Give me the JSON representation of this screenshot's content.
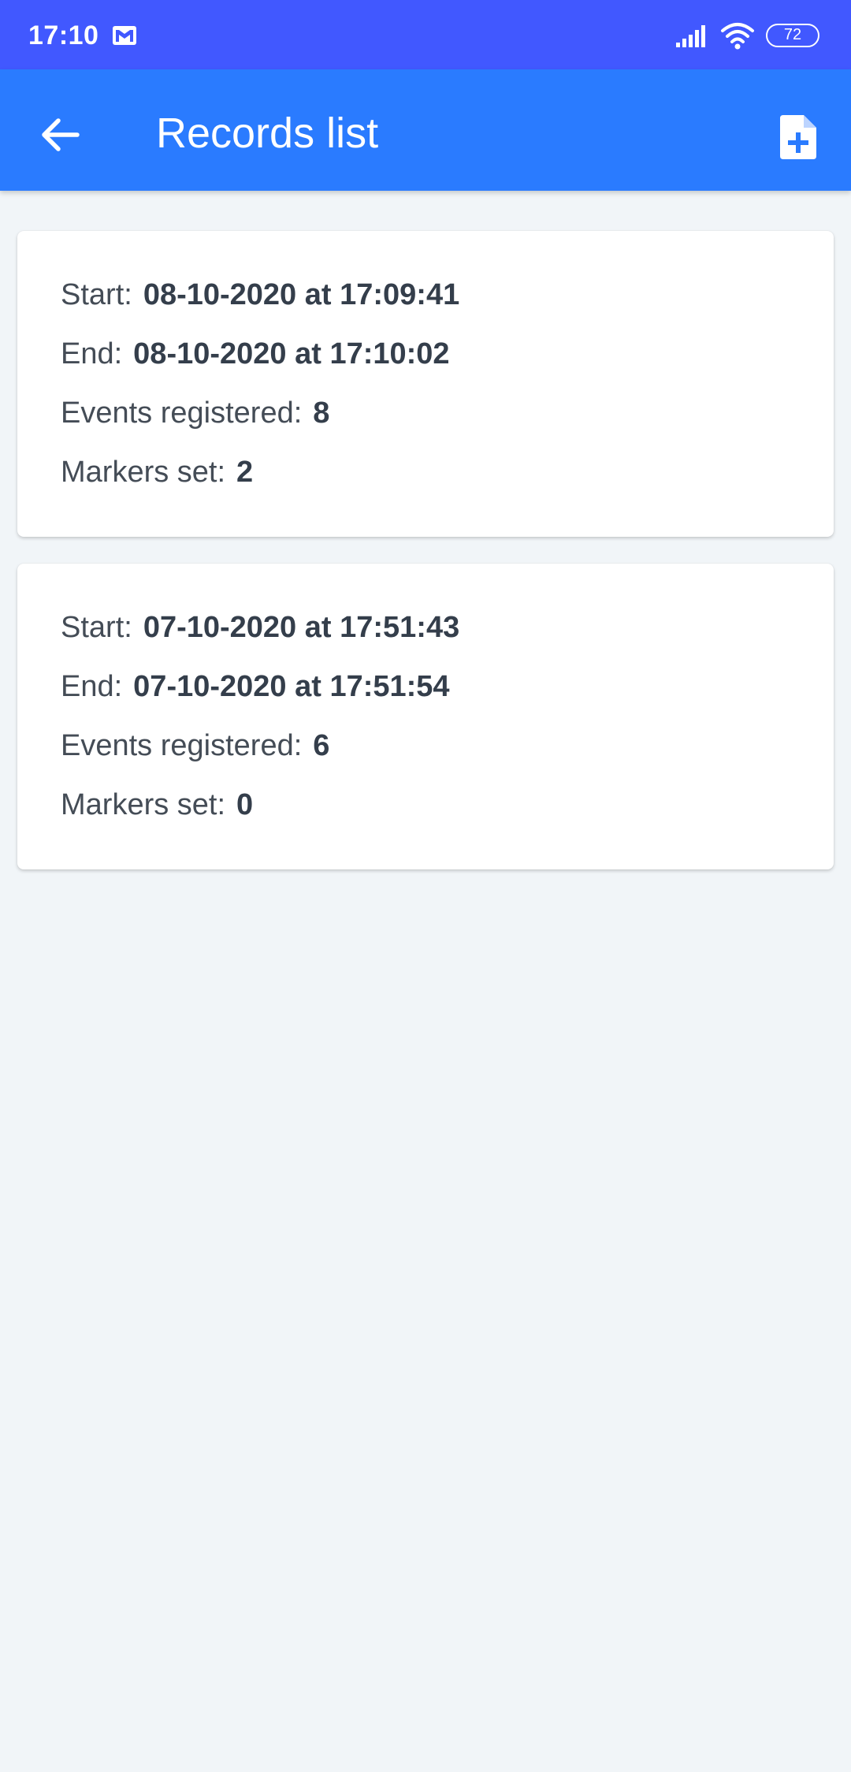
{
  "status_bar": {
    "time": "17:10",
    "battery": "72",
    "icons": [
      "gmail-icon",
      "signal-icon",
      "wifi-icon",
      "battery-icon"
    ]
  },
  "app_bar": {
    "title": "Records list",
    "back_icon": "arrow-left-icon",
    "action_icon": "file-plus-icon",
    "color": "#2a7bff",
    "status_color": "#4158ff"
  },
  "records": [
    {
      "start_label": "Start:",
      "start_value": "08-10-2020 at 17:09:41",
      "end_label": "End:",
      "end_value": "08-10-2020 at 17:10:02",
      "events_label": "Events registered:",
      "events_value": "8",
      "markers_label": "Markers set:",
      "markers_value": "2"
    },
    {
      "start_label": "Start:",
      "start_value": "07-10-2020 at 17:51:43",
      "end_label": "End:",
      "end_value": "07-10-2020 at 17:51:54",
      "events_label": "Events registered:",
      "events_value": "6",
      "markers_label": "Markers set:",
      "markers_value": "0"
    }
  ]
}
